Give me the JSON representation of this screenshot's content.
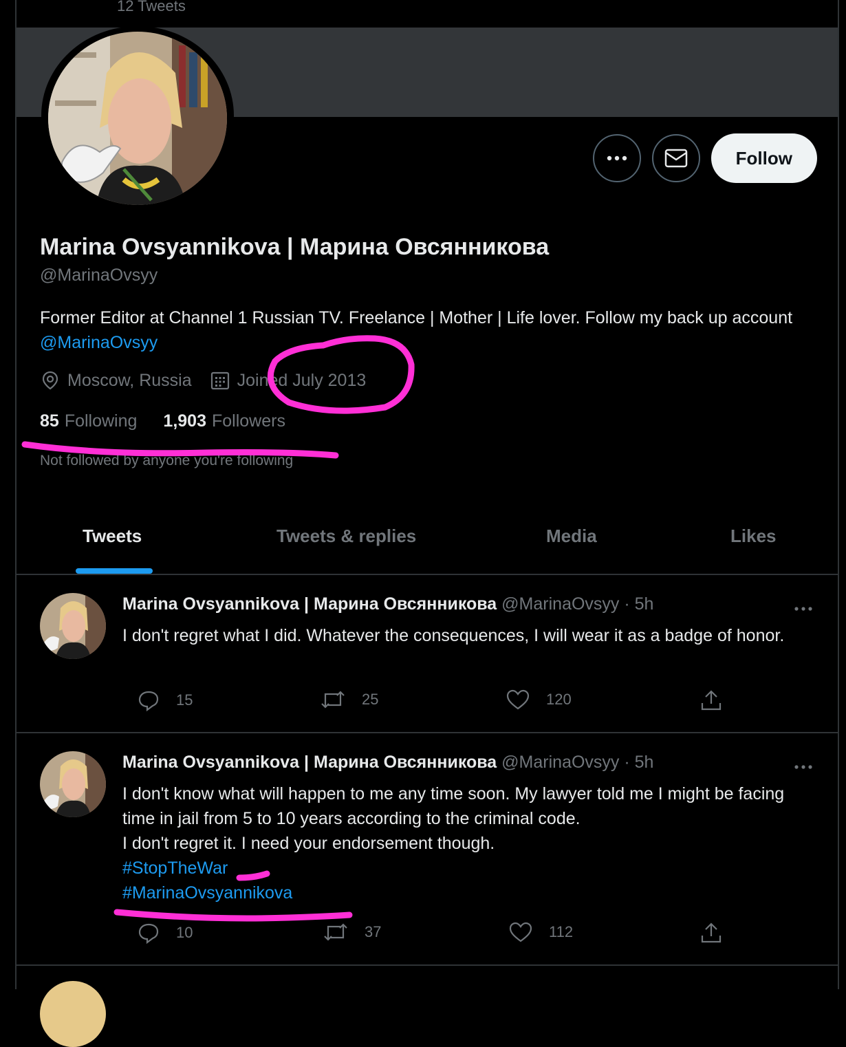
{
  "header": {
    "tweet_count": "12 Tweets"
  },
  "profile": {
    "name": "Marina Ovsyannikova | Марина Овсянникова",
    "handle": "@MarinaOvsyy",
    "bio_text": "Former Editor at Channel 1 Russian TV. Freelance | Mother | Life lover. Follow my back up account ",
    "bio_link": "@MarinaOvsyy",
    "location": "Moscow, Russia",
    "joined": "Joined July 2013",
    "following_count": "85",
    "following_label": "Following",
    "followers_count": "1,903",
    "followers_label": "Followers",
    "not_followed": "Not followed by anyone you're following",
    "follow_label": "Follow"
  },
  "tabs": [
    "Tweets",
    "Tweets & replies",
    "Media",
    "Likes"
  ],
  "tweets": [
    {
      "name": "Marina Ovsyannikova | Марина Овсянникова",
      "handle": "@MarinaOvsyy · 5h",
      "text": "I don't regret what I did. Whatever the consequences, I will wear it as a badge of honor.",
      "replies": "15",
      "retweets": "25",
      "likes": "120"
    },
    {
      "name": "Marina Ovsyannikova | Марина Овсянникова",
      "handle": "@MarinaOvsyy · 5h",
      "text_lines": [
        "I don't know what will happen to me any time soon. My lawyer told me I might be facing time in jail from 5 to 10 years according to the criminal code.",
        "I don't regret it. I need your endorsement though."
      ],
      "hashtags": [
        "#StopTheWar",
        "#MarinaOvsyannikova"
      ],
      "replies": "10",
      "retweets": "37",
      "likes": "112"
    }
  ],
  "colors": {
    "accent": "#1d9bf0",
    "annotation": "#ff2fd6",
    "muted": "#71767b"
  }
}
